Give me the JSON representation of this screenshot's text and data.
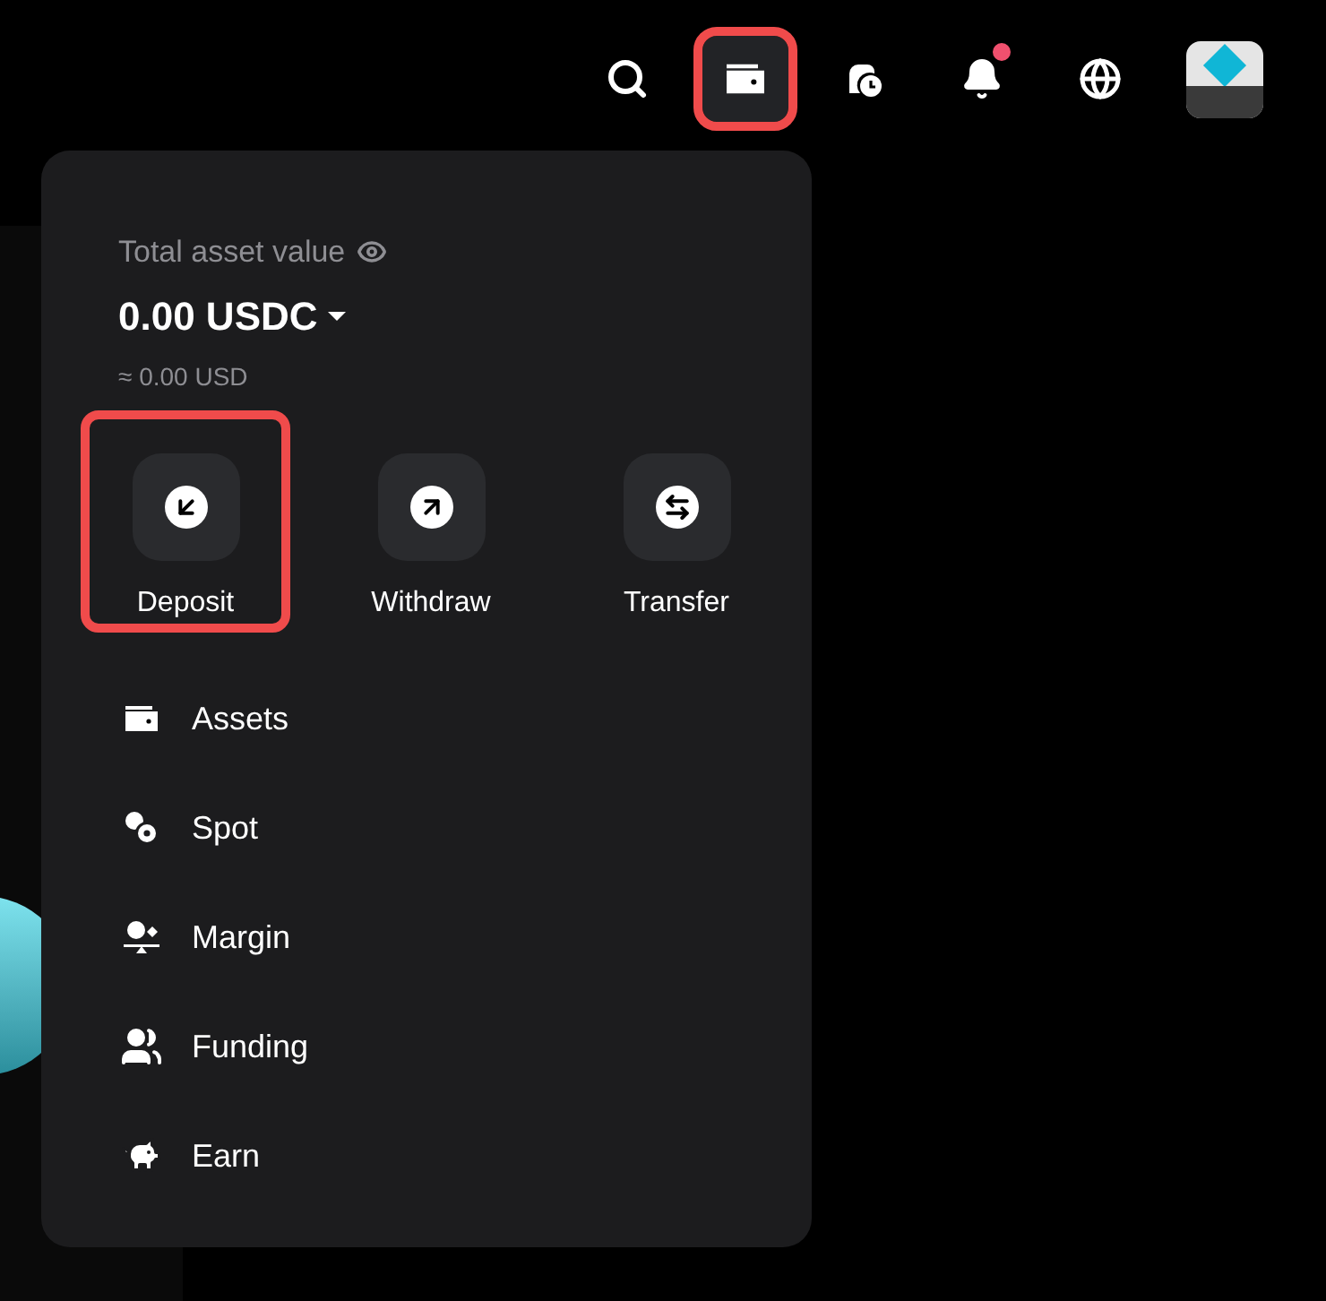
{
  "top_bar": {
    "icons": [
      {
        "kind": "search",
        "highlighted": false,
        "badge": false
      },
      {
        "kind": "wallet",
        "highlighted": true,
        "badge": false
      },
      {
        "kind": "history",
        "highlighted": false,
        "badge": false
      },
      {
        "kind": "bell",
        "highlighted": false,
        "badge": true
      },
      {
        "kind": "globe",
        "highlighted": false,
        "badge": false
      },
      {
        "kind": "avatar",
        "highlighted": false,
        "badge": false
      }
    ]
  },
  "wallet_menu": {
    "label": "Total asset value",
    "amount": "0.00 USDC",
    "fiat": "≈ 0.00 USD",
    "actions": [
      {
        "kind": "deposit",
        "label": "Deposit",
        "highlighted": true
      },
      {
        "kind": "withdraw",
        "label": "Withdraw",
        "highlighted": false
      },
      {
        "kind": "transfer",
        "label": "Transfer",
        "highlighted": false
      }
    ],
    "items": [
      {
        "kind": "assets",
        "label": "Assets"
      },
      {
        "kind": "spot",
        "label": "Spot"
      },
      {
        "kind": "margin",
        "label": "Margin"
      },
      {
        "kind": "funding",
        "label": "Funding"
      },
      {
        "kind": "earn",
        "label": "Earn"
      }
    ]
  }
}
